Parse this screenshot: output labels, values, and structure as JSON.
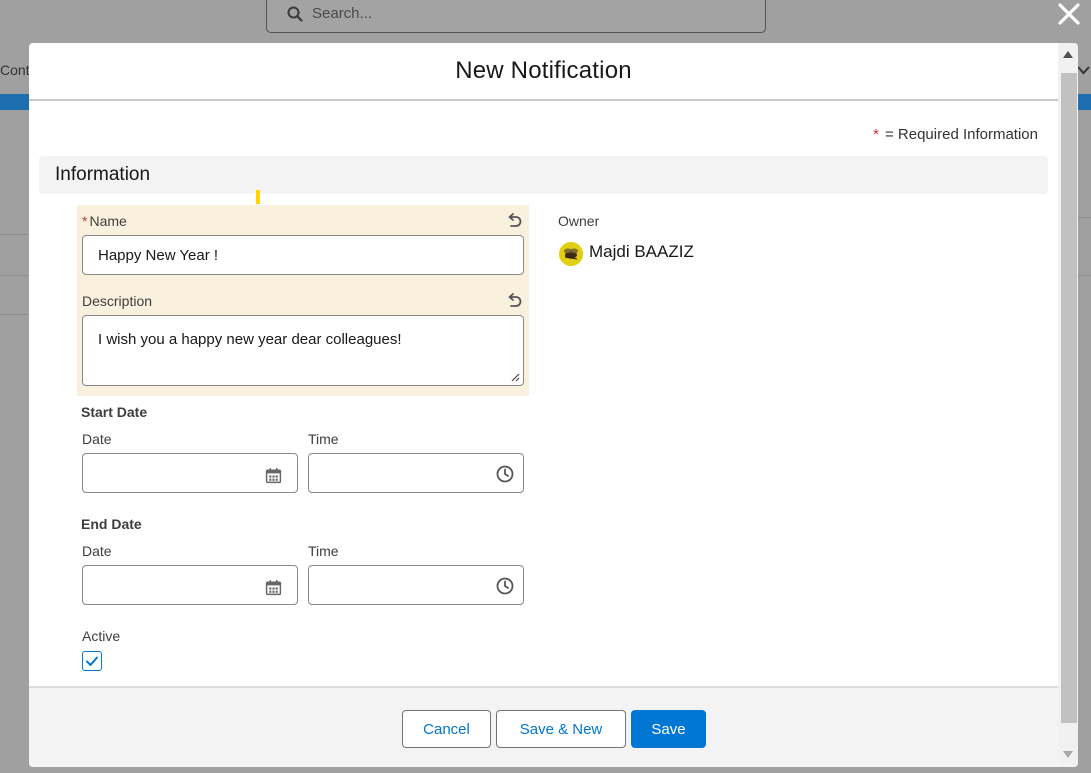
{
  "background": {
    "search_placeholder": "Search...",
    "left_text": "Cont"
  },
  "modal": {
    "title": "New Notification",
    "required_info_star": "*",
    "required_info_text": "= Required Information",
    "section_title": "Information"
  },
  "form": {
    "name": {
      "label": "Name",
      "required_marker": "*",
      "value": "Happy New Year !"
    },
    "description": {
      "label": "Description",
      "value": "I wish you a happy new year dear colleagues!"
    },
    "start_date": {
      "heading": "Start Date",
      "date_label": "Date",
      "time_label": "Time",
      "date_value": "",
      "time_value": ""
    },
    "end_date": {
      "heading": "End Date",
      "date_label": "Date",
      "time_label": "Time",
      "date_value": "",
      "time_value": ""
    },
    "active": {
      "label": "Active",
      "checked": true
    },
    "owner": {
      "label": "Owner",
      "name": "Majdi BAAZIZ"
    }
  },
  "footer": {
    "cancel_label": "Cancel",
    "save_new_label": "Save & New",
    "save_label": "Save"
  },
  "colors": {
    "brand": "#0176d3",
    "changed_field_bg": "#faf0de",
    "required_star": "#c23934",
    "overlay": "#a0a0a0"
  }
}
